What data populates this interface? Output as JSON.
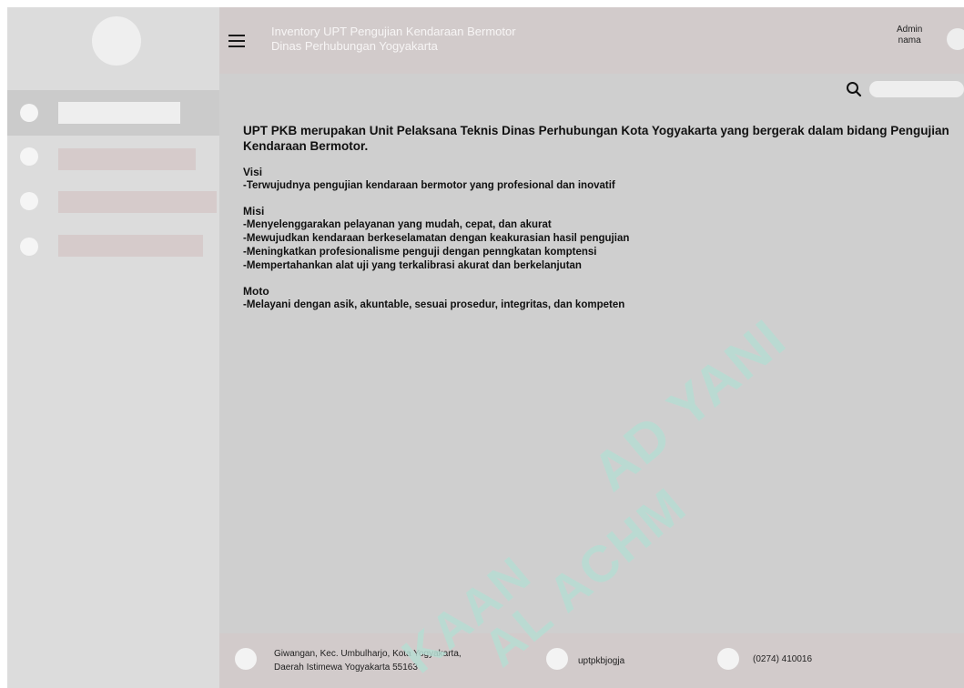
{
  "header": {
    "title_line1": "Inventory UPT Pengujian Kendaraan Bermotor",
    "title_line2": "Dinas Perhubungan Yogyakarta",
    "user_role": "Admin",
    "user_name": "nama"
  },
  "search": {
    "placeholder": ""
  },
  "about": {
    "intro": "UPT PKB merupakan Unit Pelaksana  Teknis Dinas Perhubungan Kota Yogyakarta yang bergerak dalam bidang Pengujian Kendaraan Bermotor.",
    "visi": {
      "title": "Visi",
      "items": [
        "-Terwujudnya pengujian kendaraan bermotor yang profesional dan inovatif"
      ]
    },
    "misi": {
      "title": "Misi",
      "items": [
        "-Menyelenggarakan pelayanan yang mudah, cepat, dan akurat",
        "-Mewujudkan kendaraan berkeselamatan dengan keakurasian hasil pengujian",
        "-Meningkatkan profesionalisme penguji dengan penngkatan komptensi",
        "-Mempertahankan alat uji yang terkalibrasi akurat dan berkelanjutan"
      ]
    },
    "moto": {
      "title": "Moto",
      "items": [
        "-Melayani dengan asik, akuntable, sesuai prosedur, integritas, dan kompeten"
      ]
    }
  },
  "footer": {
    "address_line1": "Giwangan, Kec. Umbulharjo, Kota Yogyakarta,",
    "address_line2": "Daerah Istimewa Yogyakarta 55163",
    "instagram": "uptpkbjogja",
    "phone": "(0274) 410016"
  },
  "watermark": {
    "line1": "AD YANI",
    "line2": "AL ACHM",
    "line3": "KAAN"
  },
  "colors": {
    "sidebar": "#dcdcdc",
    "sidebar_active": "#cbcbcb",
    "header": "#d2cbcb",
    "content": "#cfcfcf",
    "placeholder_bar": "#d6cbcb",
    "watermark": "#b7ddd3"
  },
  "icons": {
    "menu": "hamburger-icon",
    "search": "search-icon"
  }
}
